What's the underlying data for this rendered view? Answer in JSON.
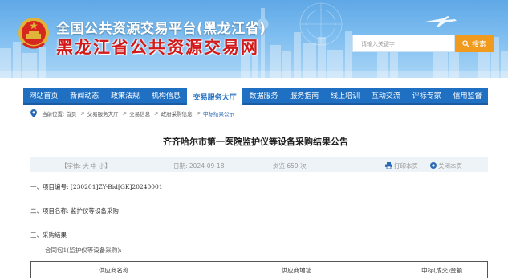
{
  "header": {
    "title_small": "全国公共资源交易平台(黑龙江省)",
    "title_big": "黑龙江省公共资源交易网",
    "search": {
      "placeholder": "请输入关键字",
      "button_label": "搜索"
    }
  },
  "nav": {
    "items": [
      {
        "label": "网站首页"
      },
      {
        "label": "新闻动态"
      },
      {
        "label": "政策法规"
      },
      {
        "label": "机构信息"
      },
      {
        "label": "交易服务大厅",
        "active": true
      },
      {
        "label": "数据服务"
      },
      {
        "label": "服务指南"
      },
      {
        "label": "线上培训"
      },
      {
        "label": "互动交流"
      },
      {
        "label": "评标专家"
      },
      {
        "label": "信用监督"
      }
    ]
  },
  "breadcrumb": {
    "prefix": "当前位置:",
    "items": [
      "首页",
      "交易服务大厅",
      "交易信息",
      "政府采购信息",
      "中标结果公示"
    ]
  },
  "article": {
    "title": "齐齐哈尔市第一医院监护仪等设备采购结果公告",
    "meta": {
      "font_label": "【字体: 大 中 小】",
      "date": "日期:  2024-09-18",
      "views": "浏览 659 次",
      "print": "打印本页",
      "close": "关闭本页"
    },
    "sections": [
      "一、项目编号: [230201]ZY-Bid[GK]20240001",
      "二、项目名称: 监护仪等设备采购",
      "三、采购结果"
    ],
    "subsection": "合同包1(监护仪等设备采购):",
    "table_headers": [
      "供应商名称",
      "供应商地址",
      "中标(成交)金额"
    ]
  },
  "colors": {
    "nav_bg": "#1f6fc2",
    "title_red": "#d31a1a",
    "search_btn": "#f09a1e",
    "meta_bg": "#eef3f8"
  }
}
